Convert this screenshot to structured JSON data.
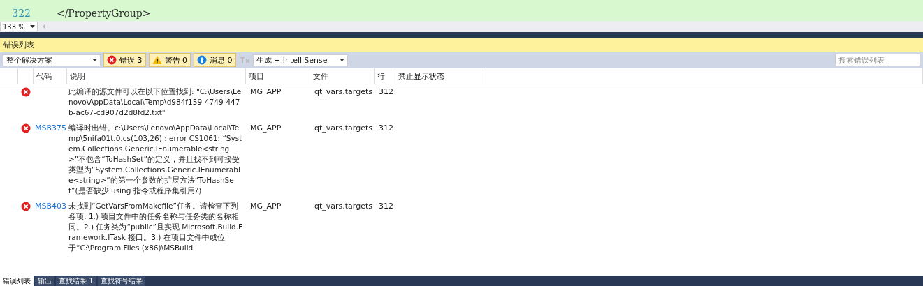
{
  "editor": {
    "lines": [
      {
        "number": "322",
        "code": "  </PropertyGroup>"
      }
    ],
    "zoom": "133 %"
  },
  "panel": {
    "title": "错误列表",
    "scope": "整个解决方案",
    "filters": [
      {
        "kind": "error",
        "label": "错误 3",
        "selected": true
      },
      {
        "kind": "warning",
        "label": "警告 0",
        "selected": true
      },
      {
        "kind": "info",
        "label": "消息 0",
        "selected": true
      }
    ],
    "source": "生成 + IntelliSense",
    "search": {
      "placeholder": "搜索错误列表"
    }
  },
  "table": {
    "columns": [
      "代码",
      "说明",
      "项目",
      "文件",
      "行",
      "禁止显示状态"
    ],
    "rows": [
      {
        "code": "",
        "description": "此编译的源文件可以在以下位置找到: \"C:\\Users\\Lenovo\\AppData\\Local\\Temp\\d984f159-4749-447b-ac67-cd907d2d8fd2.txt\"",
        "project": "MG_APP",
        "file": "qt_vars.targets",
        "line": "312"
      },
      {
        "code": "MSB375",
        "description": "编译时出错。c:\\Users\\Lenovo\\AppData\\Local\\Temp\\5nifa01t.0.cs(103,26) : error CS1061: “System.Collections.Generic.IEnumerable<string>”不包含“ToHashSet”的定义，并且找不到可接受类型为“System.Collections.Generic.IEnumerable<string>”的第一个参数的扩展方法“ToHashSet”(是否缺少 using 指令或程序集引用?)",
        "project": "MG_APP",
        "file": "qt_vars.targets",
        "line": "312"
      },
      {
        "code": "MSB403",
        "description": "未找到“GetVarsFromMakefile”任务。请检查下列各项: 1.) 项目文件中的任务名称与任务类的名称相同。2.) 任务类为“public”且实现 Microsoft.Build.Framework.ITask 接口。3.) 在项目文件中或位于“C:\\Program Files (x86)\\MSBuild",
        "project": "MG_APP",
        "file": "qt_vars.targets",
        "line": "312"
      }
    ]
  },
  "bottom_tabs": [
    {
      "label": "错误列表",
      "selected": true
    },
    {
      "label": "输出",
      "selected": false
    },
    {
      "label": "查找结果 1",
      "selected": false
    },
    {
      "label": "查找符号结果",
      "selected": false
    }
  ]
}
